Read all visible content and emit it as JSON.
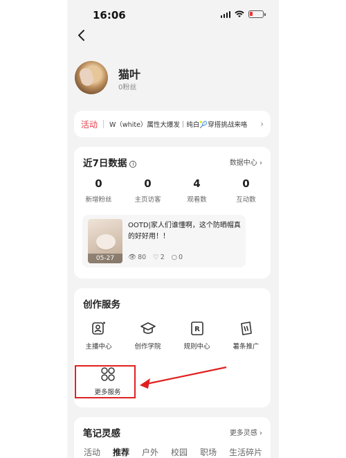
{
  "status_bar": {
    "time": "16:06"
  },
  "profile": {
    "name": "猫叶",
    "fans": "0粉丝"
  },
  "activity": {
    "tag": "活动",
    "text": "W（white）属性大爆发｜纯白🎾穿搭挑战来咯",
    "arrow": "›"
  },
  "stats": {
    "title": "近7日数据",
    "info_icon": "i",
    "data_center": "数据中心 ›",
    "metrics": [
      {
        "value": "0",
        "label": "新增粉丝"
      },
      {
        "value": "0",
        "label": "主页访客"
      },
      {
        "value": "4",
        "label": "观看数"
      },
      {
        "value": "0",
        "label": "互动数"
      }
    ],
    "note": {
      "date": "05-27",
      "title": "OOTD|家人们谁懂啊，这个防晒帽真的好好用！！",
      "views": "80",
      "likes": "2",
      "comments": "0"
    }
  },
  "services": {
    "title": "创作服务",
    "items": [
      {
        "label": "主播中心",
        "icon": "host-center-icon"
      },
      {
        "label": "创作学院",
        "icon": "graduation-cap-icon"
      },
      {
        "label": "规则中心",
        "icon": "rules-icon"
      },
      {
        "label": "薯条推广",
        "icon": "promotion-icon"
      }
    ],
    "more": {
      "label": "更多服务",
      "icon": "grid-circles-icon"
    }
  },
  "inspiration": {
    "title": "笔记灵感",
    "more": "更多灵感 ›",
    "tabs": [
      "活动",
      "推荐",
      "户外",
      "校园",
      "职场",
      "生活碎片"
    ],
    "active_tab": "推荐"
  },
  "colors": {
    "accent_red": "#e0424b",
    "annotation_red": "#e02020"
  }
}
